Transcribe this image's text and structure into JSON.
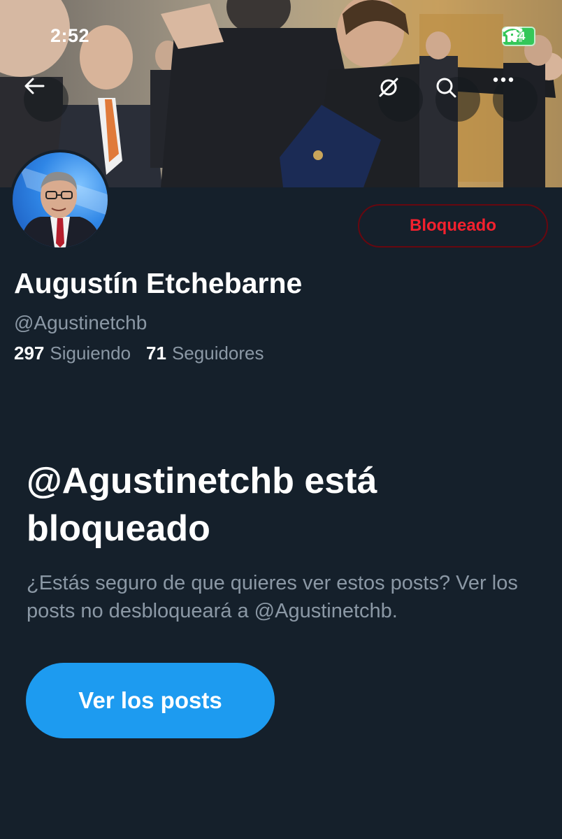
{
  "status_bar": {
    "time": "2:52",
    "battery": "44"
  },
  "header": {
    "icons": [
      "back-arrow-icon",
      "grok-icon",
      "search-icon",
      "more-icon"
    ]
  },
  "profile": {
    "name": "Augustín Etchebarne",
    "handle": "@Agustinetchb",
    "following_count": "297",
    "following_label": "Siguiendo",
    "followers_count": "71",
    "followers_label": "Seguidores",
    "blocked_button": "Bloqueado"
  },
  "notice": {
    "title": "@Agustinetchb está bloqueado",
    "body": "¿Estás seguro de que quieres ver estos posts? Ver los posts no desbloqueará a @Agustinetchb.",
    "view_button": "Ver los posts"
  },
  "colors": {
    "background": "#15202b",
    "accent": "#1d9bf0",
    "blocked_red": "#f4212e",
    "secondary_text": "#8b98a5"
  }
}
